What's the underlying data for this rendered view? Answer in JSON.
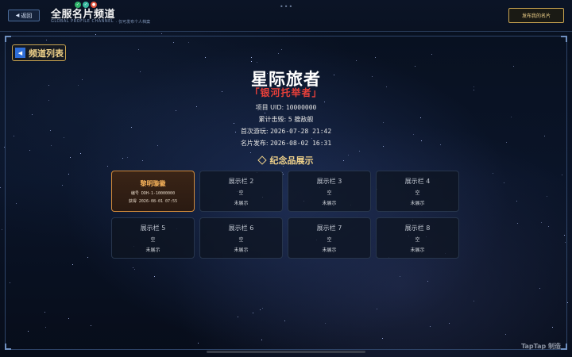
{
  "topbar": {
    "back_label": "返回",
    "channel_title": "全服名片频道",
    "channel_subtitle": "GLOBAL PROFILE CHANNEL",
    "channel_hint": "· 仅可发布个人档案",
    "publish_label": "发布我的名片"
  },
  "nav": {
    "list_label": "频道列表"
  },
  "profile": {
    "name": "星际旅者",
    "epithet": "「银河托举者」",
    "uid_label": "项目 UID:",
    "uid_value": "10000000",
    "kills_label": "累计击毁:",
    "kills_value": "5 艘敌舰",
    "first_play_label": "首次游玩:",
    "first_play_value": "2026-07-28 21:42",
    "published_label": "名片发布:",
    "published_value": "2026-08-02 16:31"
  },
  "showcase": {
    "title": "纪念品展示",
    "slots": [
      {
        "title": "黎明璇徽",
        "line1": "编号 DDH-1-10000000",
        "line2": "获得 2026-08-01 07:55",
        "filled": true
      },
      {
        "title": "展示栏 2",
        "line1": "空",
        "line2": "未展示",
        "filled": false
      },
      {
        "title": "展示栏 3",
        "line1": "空",
        "line2": "未展示",
        "filled": false
      },
      {
        "title": "展示栏 4",
        "line1": "空",
        "line2": "未展示",
        "filled": false
      },
      {
        "title": "展示栏 5",
        "line1": "空",
        "line2": "未展示",
        "filled": false
      },
      {
        "title": "展示栏 6",
        "line1": "空",
        "line2": "未展示",
        "filled": false
      },
      {
        "title": "展示栏 7",
        "line1": "空",
        "line2": "未展示",
        "filled": false
      },
      {
        "title": "展示栏 8",
        "line1": "空",
        "line2": "未展示",
        "filled": false
      }
    ]
  },
  "watermark": "TapTap 制造",
  "colors": {
    "accent_gold": "#f0d28a",
    "epithet_red": "#e8403a",
    "filled_slot_border": "#d08a3a",
    "panel_border": "#2e4468",
    "background": "#060c18"
  },
  "icons": {
    "back": "left-triangle-icon",
    "list": "left-triangle-icon",
    "section": "diamond-icon"
  }
}
